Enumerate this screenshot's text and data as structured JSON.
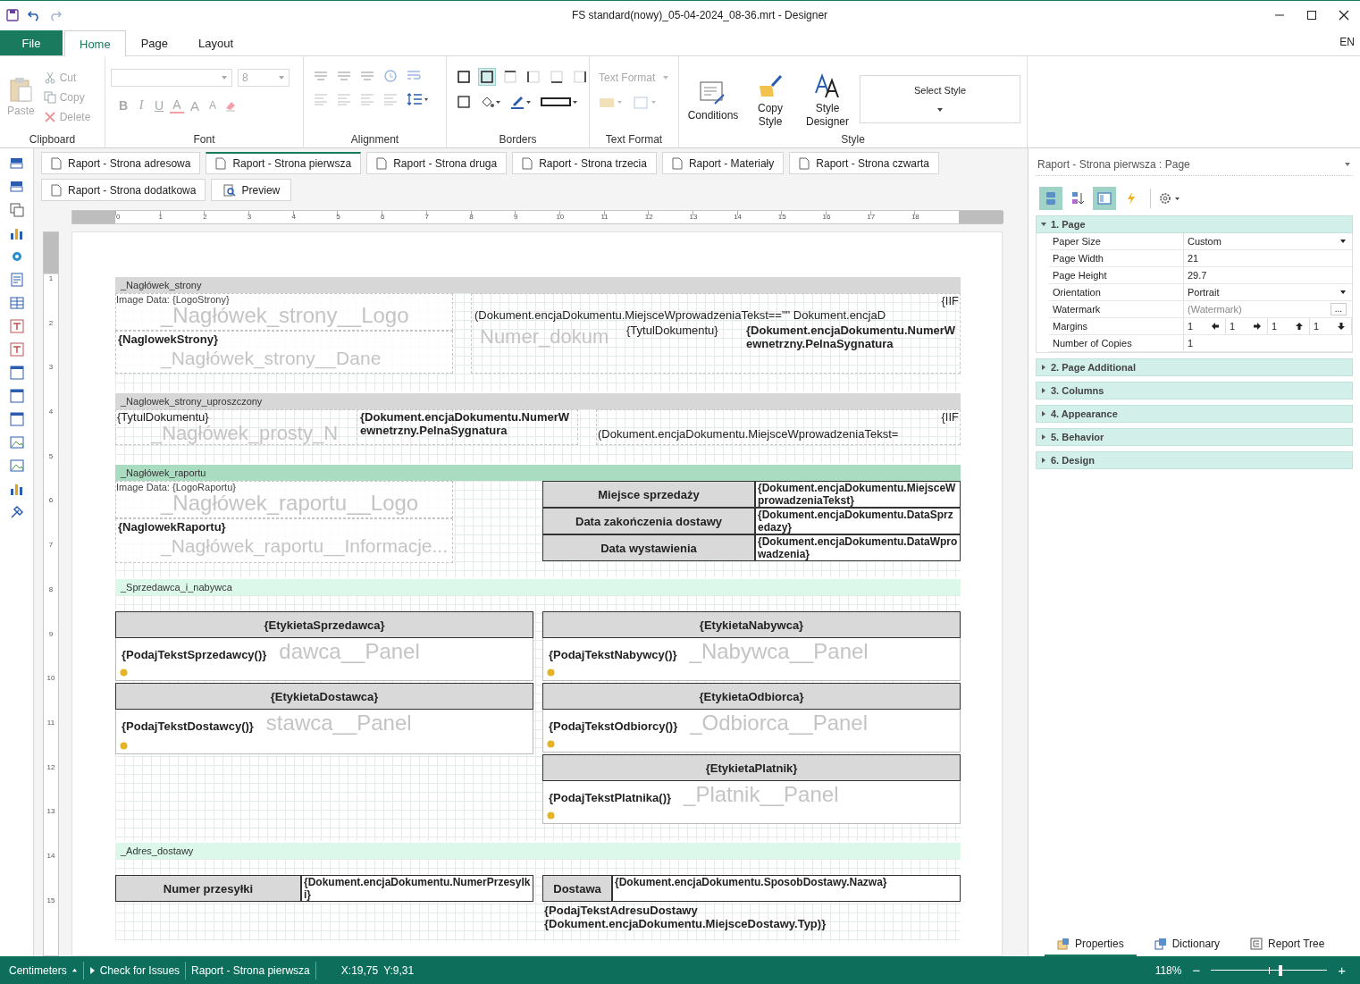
{
  "window": {
    "title": "FS standard(nowy)_05-04-2024_08-36.mrt - Designer"
  },
  "ribbon_tabs": [
    {
      "label": "File",
      "kind": "file",
      "selected": false
    },
    {
      "label": "Home",
      "kind": "tab",
      "selected": true
    },
    {
      "label": "Page",
      "kind": "tab",
      "selected": false
    },
    {
      "label": "Layout",
      "kind": "tab",
      "selected": false
    }
  ],
  "language": "EN",
  "ribbon": {
    "clipboard": {
      "label": "Clipboard",
      "paste": {
        "label": "Paste",
        "disabled": true
      },
      "items": [
        {
          "label": "Cut",
          "kind": "cut",
          "disabled": true
        },
        {
          "label": "Copy",
          "kind": "copy",
          "disabled": true
        },
        {
          "label": "Delete",
          "kind": "delete",
          "disabled": true
        }
      ]
    },
    "font": {
      "label": "Font",
      "size": "8",
      "buttons": [
        {
          "label": "B",
          "kind": "bold"
        },
        {
          "label": "I",
          "kind": "italic"
        },
        {
          "label": "U",
          "kind": "underline"
        },
        {
          "label": "A",
          "kind": "color"
        },
        {
          "label": "A",
          "kind": "grow"
        },
        {
          "label": "A",
          "kind": "shrink"
        }
      ]
    },
    "alignment": {
      "label": "Alignment"
    },
    "borders": {
      "label": "Borders"
    },
    "text_format": {
      "label": "Text Format",
      "dropdown": "Text Format"
    },
    "style": {
      "label": "Style",
      "buttons": [
        {
          "label": "Conditions",
          "kind": "conditions"
        },
        {
          "label": "Copy Style",
          "kind": "copy_style"
        },
        {
          "label": "Style Designer",
          "kind": "style_designer"
        }
      ],
      "select_style": "Select Style"
    }
  },
  "page_tabs": [
    {
      "label": "Raport - Strona adresowa",
      "selected": false
    },
    {
      "label": "Raport - Strona pierwsza",
      "selected": true
    },
    {
      "label": "Raport - Strona druga",
      "selected": false
    },
    {
      "label": "Raport - Strona trzecia",
      "selected": false
    },
    {
      "label": "Raport - Materiały",
      "selected": false
    },
    {
      "label": "Raport - Strona czwarta",
      "selected": false
    },
    {
      "label": "Raport - Strona dodatkowa",
      "selected": false
    }
  ],
  "preview_button": "Preview",
  "ruler": {
    "ticks": [
      "0",
      "1",
      "2",
      "3",
      "4",
      "5",
      "6",
      "7",
      "8",
      "9",
      "10",
      "11",
      "12",
      "13",
      "14",
      "15",
      "16",
      "17",
      "18"
    ]
  },
  "vertical_ruler": {
    "ticks": [
      "1",
      "2",
      "3",
      "4",
      "5",
      "6",
      "7",
      "8",
      "9",
      "10",
      "11",
      "12",
      "13",
      "14",
      "15"
    ]
  },
  "bands": [
    {
      "name": "_Nagłówek_strony",
      "kind": "page_header",
      "components": [
        {
          "kind": "image",
          "caption": "Image Data: {LogoStrony}",
          "watermark": "_Nagłówek_strony__Logo"
        },
        {
          "kind": "field",
          "text": "{NaglowekStrony}",
          "watermark": "_Nagłówek_strony__Dane"
        },
        {
          "kind": "text",
          "text": "{IIF"
        },
        {
          "kind": "text",
          "text": "(Dokument.encjaDokumentu.MiejsceWprowadzeniaTekst==\"\" Dokument.encjaD"
        },
        {
          "kind": "ghost",
          "text": "Numer_dokum"
        },
        {
          "kind": "text",
          "text": "{TytulDokumentu}"
        },
        {
          "kind": "bold",
          "text": "{Dokument.encjaDokumentu.NumerWewnetrzny.PelnaSygnatura"
        }
      ]
    },
    {
      "name": "_Naglowek_strony_uproszczony",
      "kind": "page_header",
      "components": [
        {
          "kind": "text",
          "text": "{TytulDokumentu}"
        },
        {
          "kind": "ghost",
          "text": "_Nagłówek_prosty_N"
        },
        {
          "kind": "bold",
          "text": "{Dokument.encjaDokumentu.NumerWewnetrzny.PelnaSygnatura"
        },
        {
          "kind": "text",
          "text": "{IIF"
        },
        {
          "kind": "text",
          "text": "(Dokument.encjaDokumentu.MiejsceWprowadzeniaTekst="
        }
      ]
    },
    {
      "name": "_Nagłówek_raportu",
      "kind": "report_header",
      "components": [
        {
          "kind": "image",
          "caption": "Image Data: {LogoRaportu}",
          "watermark": "_Nagłówek_raportu__Logo"
        },
        {
          "kind": "field",
          "text": "{NaglowekRaportu}",
          "watermark": "_Nagłówek_raportu__Informacje..."
        },
        {
          "kind": "label_cell",
          "text": "Miejsce sprzedaży"
        },
        {
          "kind": "value_cell",
          "text": "{Dokument.encjaDokumentu.MiejsceWprowadzeniaTekst}"
        },
        {
          "kind": "label_cell",
          "text": "Data zakończenia dostawy"
        },
        {
          "kind": "value_cell",
          "text": "{Dokument.encjaDokumentu.DataSprzedazy}"
        },
        {
          "kind": "label_cell",
          "text": "Data wystawienia"
        },
        {
          "kind": "value_cell",
          "text": "{Dokument.encjaDokumentu.DataWprowadzenia}"
        }
      ]
    },
    {
      "name": "_Sprzedawca_i_nabywca",
      "kind": "data",
      "components": [
        {
          "kind": "panel_header",
          "text": "{EtykietaSprzedawca}"
        },
        {
          "kind": "panel_body",
          "text": "{PodajTekstSprzedawcy()}",
          "watermark": "dawca__Panel"
        },
        {
          "kind": "panel_header",
          "text": "{EtykietaNabywca}"
        },
        {
          "kind": "panel_body",
          "text": "{PodajTekstNabywcy()}",
          "watermark": "_Nabywca__Panel"
        },
        {
          "kind": "panel_header",
          "text": "{EtykietaDostawca}"
        },
        {
          "kind": "panel_body",
          "text": "{PodajTekstDostawcy()}",
          "watermark": "stawca__Panel"
        },
        {
          "kind": "panel_header",
          "text": "{EtykietaOdbiorca}"
        },
        {
          "kind": "panel_body",
          "text": "{PodajTekstOdbiorcy()}",
          "watermark": "_Odbiorca__Panel"
        },
        {
          "kind": "panel_header",
          "text": "{EtykietaPlatnik}"
        },
        {
          "kind": "panel_body",
          "text": "{PodajTekstPlatnika()}",
          "watermark": "_Platnik__Panel"
        }
      ]
    },
    {
      "name": "_Adres_dostawy",
      "kind": "data",
      "components": [
        {
          "kind": "label_cell",
          "text": "Numer przesyłki"
        },
        {
          "kind": "value_cell",
          "text": "{Dokument.encjaDokumentu.NumerPrzesylki}"
        },
        {
          "kind": "label_cell",
          "text": "Dostawa"
        },
        {
          "kind": "value_cell",
          "text": "{Dokument.encjaDokumentu.SposobDostawy.Nazwa}"
        },
        {
          "kind": "bold",
          "text": "{PodajTekstAdresuDostawy\n{Dokument.encjaDokumentu.MiejsceDostawy.Typ)}"
        }
      ]
    }
  ],
  "properties": {
    "title": "Raport - Strona pierwsza : Page",
    "toolbar": [
      {
        "kind": "categorized",
        "selected": true
      },
      {
        "kind": "alphabetical",
        "selected": false
      },
      {
        "kind": "properties",
        "selected": true
      },
      {
        "kind": "events",
        "selected": false
      }
    ],
    "categories": [
      {
        "label": "1. Page",
        "expanded": true,
        "rows": [
          {
            "name": "Paper Size",
            "kind": "dropdown",
            "value": "Custom"
          },
          {
            "name": "Page Width",
            "kind": "text",
            "value": "21"
          },
          {
            "name": "Page Height",
            "kind": "text",
            "value": "29.7"
          },
          {
            "name": "Orientation",
            "kind": "dropdown",
            "value": "Portrait"
          },
          {
            "name": "Watermark",
            "kind": "dialog",
            "value": "(Watermark)",
            "button": "..."
          },
          {
            "name": "Margins",
            "kind": "margins",
            "values": [
              "1",
              "1",
              "1",
              "1"
            ]
          },
          {
            "name": "Number of Copies",
            "kind": "text",
            "value": "1"
          }
        ]
      },
      {
        "label": "2. Page  Additional",
        "expanded": false
      },
      {
        "label": "3. Columns",
        "expanded": false
      },
      {
        "label": "4. Appearance",
        "expanded": false
      },
      {
        "label": "5. Behavior",
        "expanded": false
      },
      {
        "label": "6. Design",
        "expanded": false
      }
    ]
  },
  "panel_tabs": [
    {
      "label": "Properties",
      "kind": "properties",
      "selected": true
    },
    {
      "label": "Dictionary",
      "kind": "dictionary",
      "selected": false
    },
    {
      "label": "Report Tree",
      "kind": "tree",
      "selected": false
    }
  ],
  "status_bar": {
    "units": "Centimeters",
    "check": "Check for Issues",
    "page": "Raport - Strona pierwsza",
    "x": "X:19,75",
    "y": "Y:9,31",
    "zoom": "118%",
    "zoom_out": "−",
    "zoom_in": "+",
    "zoom_slider": {
      "level": 0.6
    }
  }
}
